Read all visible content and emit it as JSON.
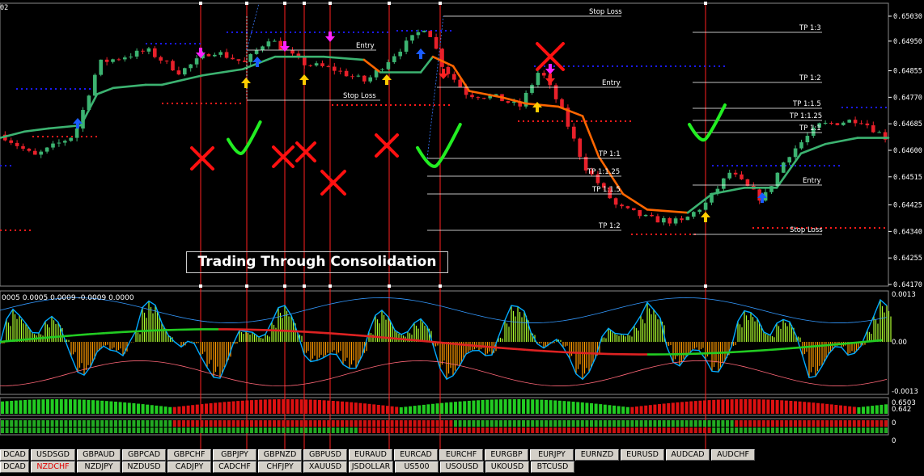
{
  "chart_data": [
    {
      "type": "candlestick",
      "title": "",
      "caption": "Trading Through Consolidation",
      "price_labels": [
        "0.65030",
        "0.64950",
        "0.64855",
        "0.64770",
        "0.64685",
        "0.64600",
        "0.64515",
        "0.64425",
        "0.64340",
        "0.64255",
        "0.64170"
      ],
      "corner_label": "02",
      "ylim": [
        0.6417,
        0.6503
      ],
      "levels": {
        "trade_1": [
          "Entry",
          "Stop Loss"
        ],
        "trade_2": [
          "Stop Loss",
          "Entry",
          "TP 1:1",
          "TP 1:1.25",
          "TP 1:1.5",
          "TP 1:2"
        ],
        "trade_3": [
          "TP 1:3",
          "TP 1:2",
          "TP 1:1.5",
          "TP 1:1.25",
          "TP 1:1",
          "Entry",
          "Stop Loss"
        ]
      },
      "colors": {
        "bull": "#3cb371",
        "bear": "#e8202a",
        "ma_bull": "#3cb371",
        "ma_bear": "#ff6600",
        "dots_top": "#1a1aff",
        "dots_bottom": "#ff1a1a",
        "vline": "#ff2020",
        "check": "#22ee22",
        "cross": "#ff1010"
      }
    },
    {
      "type": "histogram",
      "header": "0005 0.0005 0.0009 -0.0009 0.0000",
      "scale_labels": [
        "0.0013",
        "0.00",
        "-0.0013"
      ],
      "colors": {
        "up": "#adff2f",
        "down": "#ff9900",
        "line1": "#00aaff",
        "line2": "#ff3333"
      }
    },
    {
      "type": "bar",
      "scale_labels": [
        "0.6503",
        "0.642"
      ],
      "colors": {
        "up": "#22cc22",
        "down": "#dd1111"
      }
    },
    {
      "type": "bar",
      "scale_labels": [
        "0",
        "0"
      ],
      "colors": {
        "up": "#22aa22",
        "down": "#cc1111"
      }
    }
  ],
  "symbols": {
    "row1": [
      "DCAD",
      "USDSGD",
      "GBPAUD",
      "GBPCAD",
      "GBPCHF",
      "GBPJPY",
      "GBPNZD",
      "GBPUSD",
      "EURAUD",
      "EURCAD",
      "EURCHF",
      "EURGBP",
      "EURJPY",
      "EURNZD",
      "EURUSD",
      "AUDCAD",
      "AUDCHF"
    ],
    "row2": [
      "DCAD",
      "NZDCHF",
      "NZDJPY",
      "NZDUSD",
      "CADJPY",
      "CADCHF",
      "CHFJPY",
      "XAUUSD",
      "JSDOLLAR",
      "US500",
      "USOUSD",
      "UKOUSD",
      "BTCUSD"
    ],
    "active": "NZDCHF"
  }
}
